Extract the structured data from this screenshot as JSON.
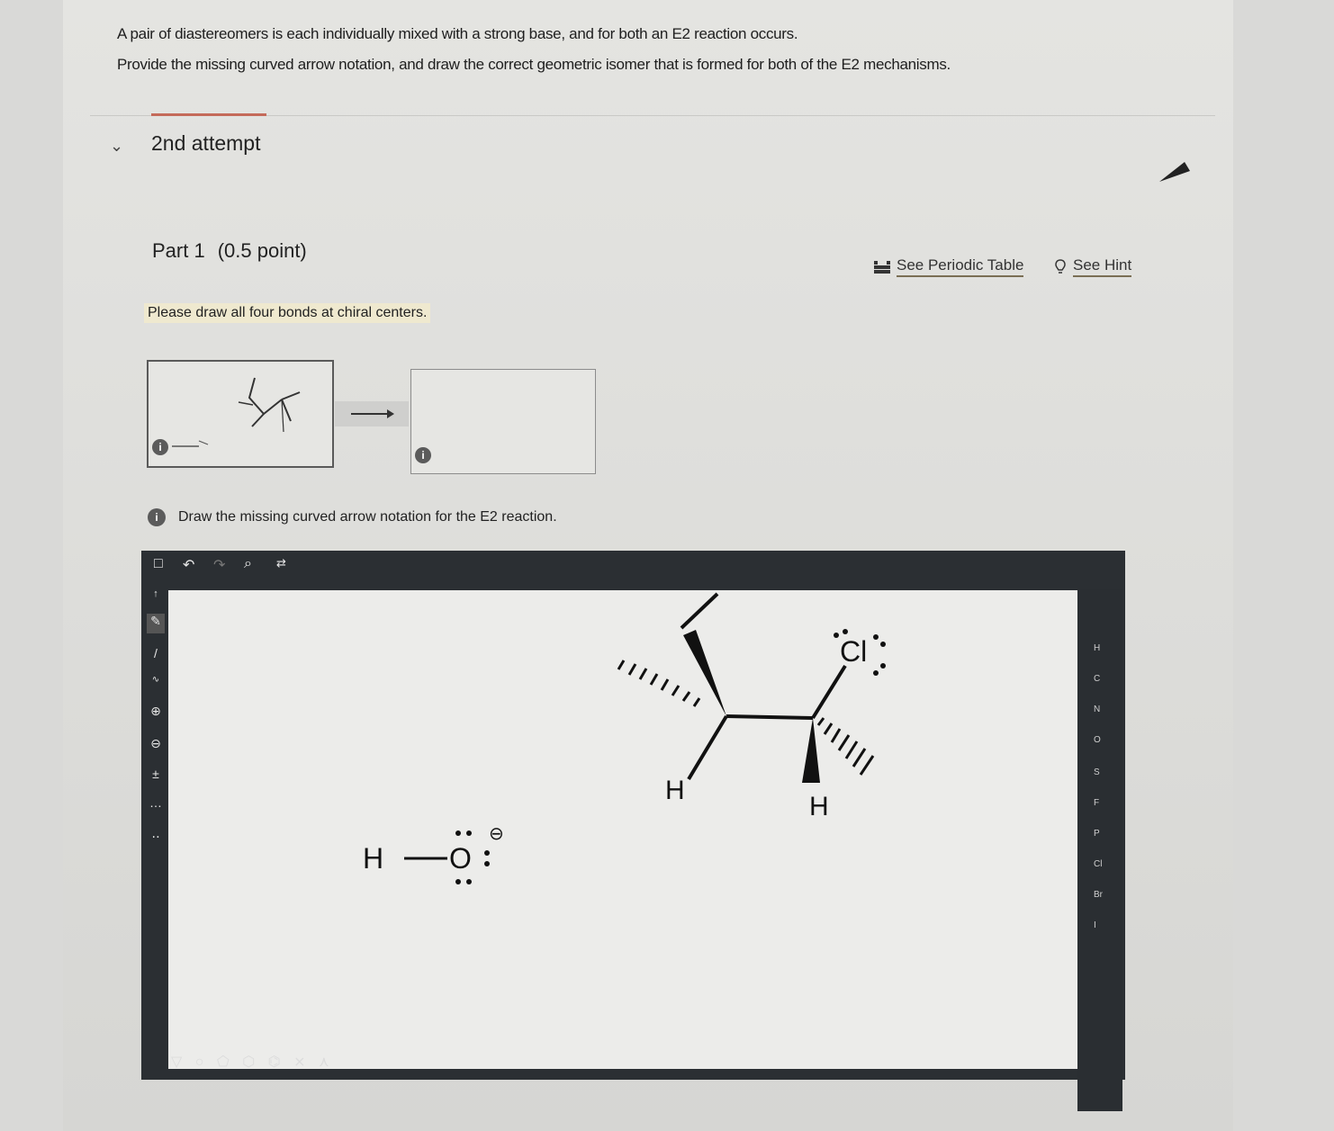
{
  "question": {
    "line1": "A pair of diastereomers is each individually mixed with a strong base, and for both an E2 reaction occurs.",
    "line2": "Provide the missing curved arrow notation, and draw the correct geometric isomer that is formed for both of the E2 mechanisms."
  },
  "attempt": {
    "label": "2nd attempt"
  },
  "part": {
    "title": "Part 1",
    "points": "(0.5 point)"
  },
  "links": {
    "periodic_table": "See Periodic Table",
    "hint": "See Hint"
  },
  "notice": "Please draw all four bonds at chiral centers.",
  "instruction": "Draw the missing curved arrow notation for the E2 reaction.",
  "info_glyph": "i",
  "molecule": {
    "leaving_group": "Cl",
    "h_left": "H",
    "h_right": "H",
    "base_h": "H",
    "base_o": "O",
    "charge": "⊖"
  },
  "right_toolbar": [
    "H",
    "C",
    "N",
    "O",
    "S",
    "F",
    "P",
    "Cl",
    "Br",
    "I"
  ],
  "colors": {
    "editor_frame": "#2b2f33",
    "canvas": "#ececea",
    "accent": "#c46a5a"
  }
}
